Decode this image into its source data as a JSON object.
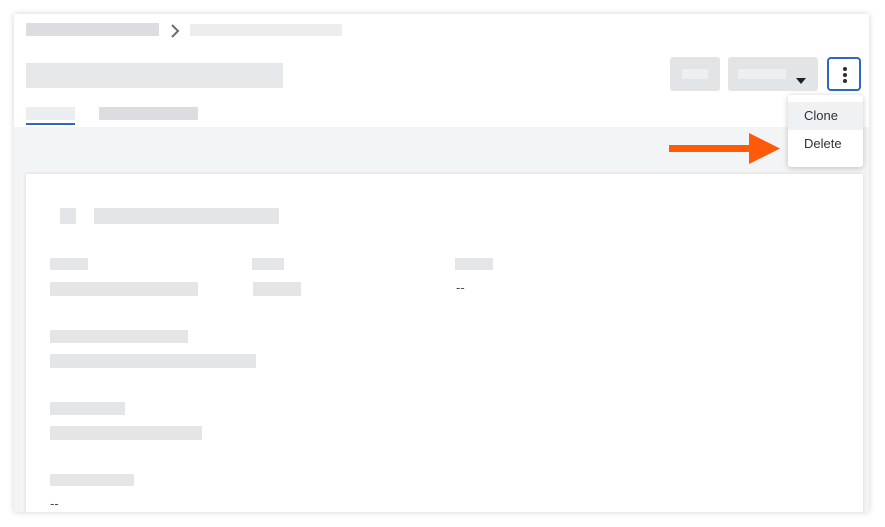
{
  "menu": {
    "items": [
      {
        "label": "Clone"
      },
      {
        "label": "Delete"
      }
    ]
  },
  "details": {
    "field_3_value": "--",
    "field_7_value": "--"
  },
  "colors": {
    "accent": "#2f66c0",
    "annotation_arrow": "#ff5a0a",
    "placeholder": "#e4e5e7",
    "page_background": "#f3f4f5"
  },
  "icons": {
    "breadcrumb_separator": "chevron-right-icon",
    "dropdown_caret": "caret-down-icon",
    "more_actions": "kebab-vertical-icon",
    "annotation": "arrow-right-icon"
  }
}
